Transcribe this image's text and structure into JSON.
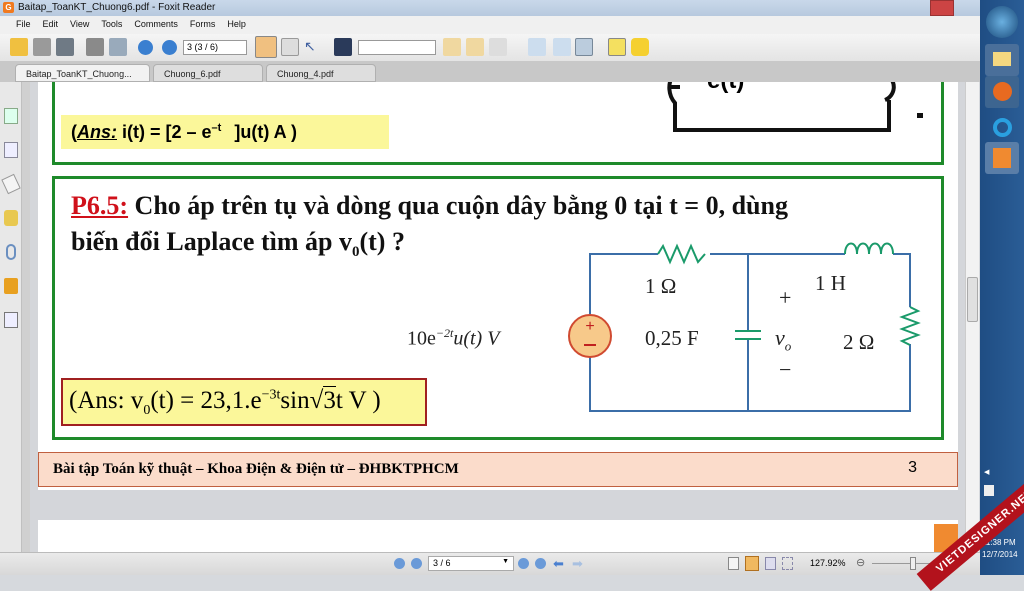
{
  "window": {
    "title": "Baitap_ToanKT_Chuong6.pdf - Foxit Reader",
    "app_icon": "G"
  },
  "menu": [
    "File",
    "Edit",
    "View",
    "Tools",
    "Comments",
    "Forms",
    "Help"
  ],
  "toolbar": {
    "page_field": "3 (3 / 6)"
  },
  "tabs": [
    {
      "label": "Baitap_ToanKT_Chuong...",
      "close": "x"
    },
    {
      "label": "Chuong_6.pdf"
    },
    {
      "label": "Chuong_4.pdf"
    }
  ],
  "doc": {
    "prev_answer": {
      "prefix": "(",
      "ans": "Ans:",
      "formula": "i(t) = [2 – e",
      "exp": "–t",
      "rest": "]u(t)  A )"
    },
    "prev_circuit_label": "e(t)",
    "problem": {
      "id": "P6.5:",
      "text1": "Cho áp trên tụ và dòng qua cuộn dây bằng 0 tại t = 0, dùng",
      "text2a": "biến đổi  Laplace tìm áp v",
      "text2sub": "0",
      "text2b": "(t) ?"
    },
    "answer": {
      "a": "(Ans: v",
      "sub": "0",
      "b": "(t) = 23,1.e",
      "exp": "−3t",
      "c": "sin",
      "sqrt": "3",
      "d": "t V )"
    },
    "circuit": {
      "source": "10e",
      "source_exp": "−2t",
      "source_rest": "u(t) V",
      "r1": "1 Ω",
      "l1": "1 H",
      "c1": "0,25 F",
      "vo": "v",
      "vo_sub": "o",
      "plus": "+",
      "minus": "−",
      "r2": "2 Ω"
    },
    "footer": {
      "text": "Bài tập Toán kỹ thuật – Khoa Điện & Điện tử – ĐHBKTPHCM",
      "page_number": "3"
    }
  },
  "statusbar": {
    "page": "3 / 6",
    "zoom": "127.92%"
  },
  "taskbar": {
    "time": "11:38 PM",
    "date": "12/7/2014"
  },
  "watermark": "VIETDESIGNER.NET"
}
